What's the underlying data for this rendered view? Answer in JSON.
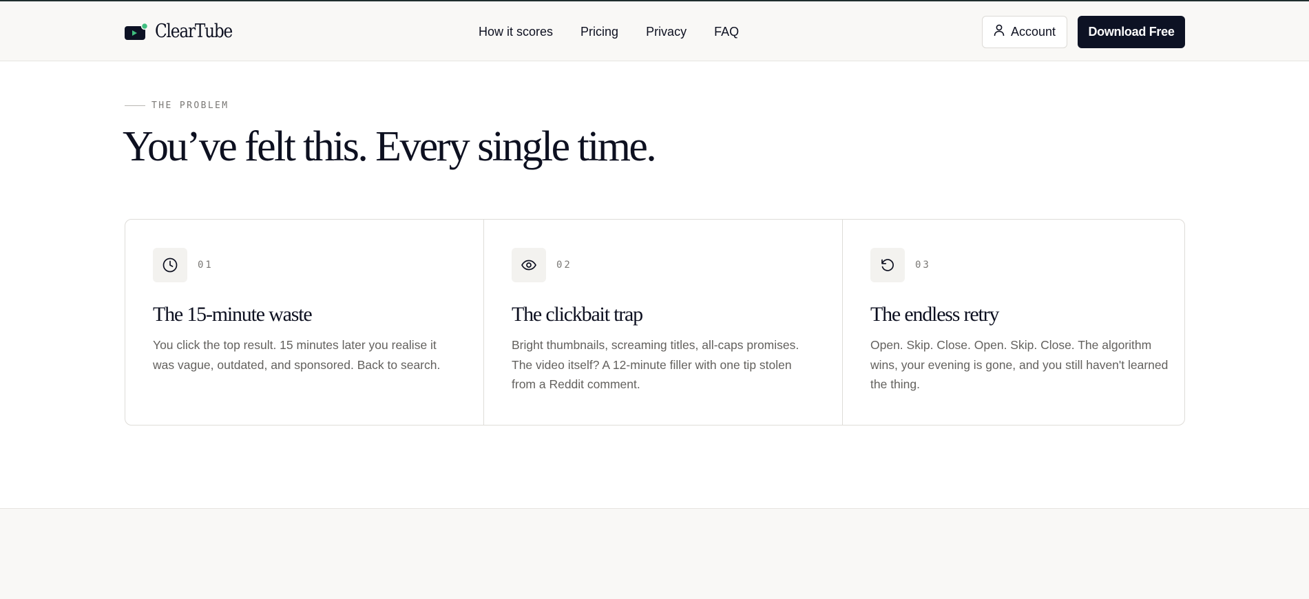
{
  "brand": {
    "name": "ClearTube",
    "accent": "#3fbf7f"
  },
  "nav": {
    "items": [
      "How it scores",
      "Pricing",
      "Privacy",
      "FAQ"
    ]
  },
  "header": {
    "account_label": "Account",
    "download_label": "Download Free"
  },
  "section": {
    "eyebrow": "THE PROBLEM",
    "title": "You’ve felt this. Every single time."
  },
  "cards": [
    {
      "icon": "clock-icon",
      "number": "01",
      "title": "The 15-minute waste",
      "body": "You click the top result. 15 minutes later you realise it was vague, outdated, and sponsored. Back to search."
    },
    {
      "icon": "eye-icon",
      "number": "02",
      "title": "The clickbait trap",
      "body": "Bright thumbnails, screaming titles, all-caps promises. The video itself? A 12-minute filler with one tip stolen from a Reddit comment."
    },
    {
      "icon": "retry-icon",
      "number": "03",
      "title": "The endless retry",
      "body": "Open. Skip. Close. Open. Skip. Close. The algorithm wins, your evening is gone, and you still haven't learned the thing."
    }
  ]
}
